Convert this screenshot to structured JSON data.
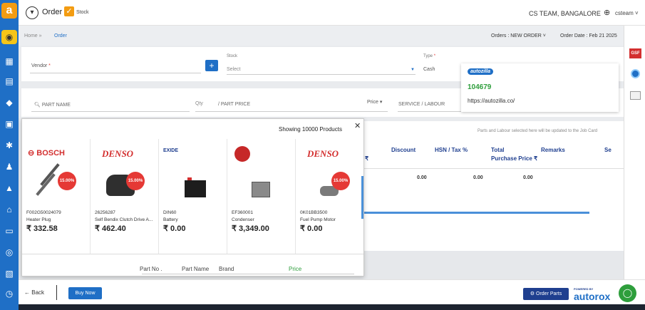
{
  "app": {
    "logo_letter": "a"
  },
  "leftbar": {
    "icons": [
      "account-icon",
      "calendar-icon",
      "document-icon",
      "tag-icon",
      "inventory-icon",
      "settings-icon",
      "users-icon",
      "notification-icon",
      "home-icon",
      "id-icon",
      "currency-icon",
      "report-icon",
      "timer-icon"
    ]
  },
  "header": {
    "title": "Order",
    "stock_label": "Stock",
    "team": "CS TEAM, BANGALORE",
    "user": "csteam"
  },
  "breadcrumb": {
    "home": "Home",
    "separator": "»",
    "current": "Order",
    "orders_label": "Orders :",
    "orders_value": "NEW ORDER",
    "order_date": "Order Date : Feb 21 2025"
  },
  "form": {
    "vendor_label": "Vendor",
    "stock_label": "Stock",
    "stock_placeholder": "Select",
    "type_label": "Type",
    "type_value": "Cash",
    "part_name_placeholder": "PART NAME",
    "qty_placeholder": "Qty",
    "part_price_placeholder": "/ PART PRICE",
    "price_label": "Price",
    "service_placeholder": "SERVICE / LABOUR"
  },
  "popover": {
    "logo_text": "autozilla",
    "code": "104679",
    "url": "https://autozilla.co/"
  },
  "table": {
    "note": "Parts and Labour selected here will be updated to the Job Card",
    "currency_fragment": "₹",
    "headers": {
      "discount": "Discount",
      "hsn_tax": "HSN / Tax %",
      "total_purchase": "Total",
      "total_purchase_2": "Purchase Price ₹",
      "remarks": "Remarks",
      "se": "Se"
    },
    "row": {
      "v1": "0.00",
      "v2": "0.00",
      "v3": "0.00"
    }
  },
  "products_panel": {
    "showing": "Showing 10000 Products",
    "products": [
      {
        "brand": "BOSCH",
        "discount": "15.00%",
        "code": "F002G50024079",
        "name": "Heater Plug",
        "price": "₹ 332.58"
      },
      {
        "brand": "DENSO",
        "discount": "15.00%",
        "code": "26256287",
        "name": "Self Bendix Clutch Drive A...",
        "price": "₹ 462.40"
      },
      {
        "brand": "EXIDE",
        "code": "DIN60",
        "name": "Battery",
        "price": "₹ 0.00"
      },
      {
        "brand": "",
        "code": "EF360001",
        "name": "Condenser",
        "price": "₹ 3,349.00"
      },
      {
        "brand": "DENSO",
        "discount": "15.00%",
        "code": "0K01BB3500",
        "name": "Fuel Pump Motor",
        "price": "₹ 0.00"
      }
    ],
    "columns": {
      "part_no": "Part No .",
      "part_name": "Part Name",
      "brand": "Brand",
      "price": "Price"
    }
  },
  "footer": {
    "back": "Back",
    "buy_now": "Buy Now",
    "order_parts": "Order Parts",
    "powered_by": "POWERED BY",
    "brand": "autorox"
  },
  "right_tools": {
    "gsf_label": "GSF"
  },
  "colors": {
    "primary": "#1f6fc6",
    "accent": "#f39c12",
    "success": "#2e9e3c",
    "danger": "#e53935"
  }
}
